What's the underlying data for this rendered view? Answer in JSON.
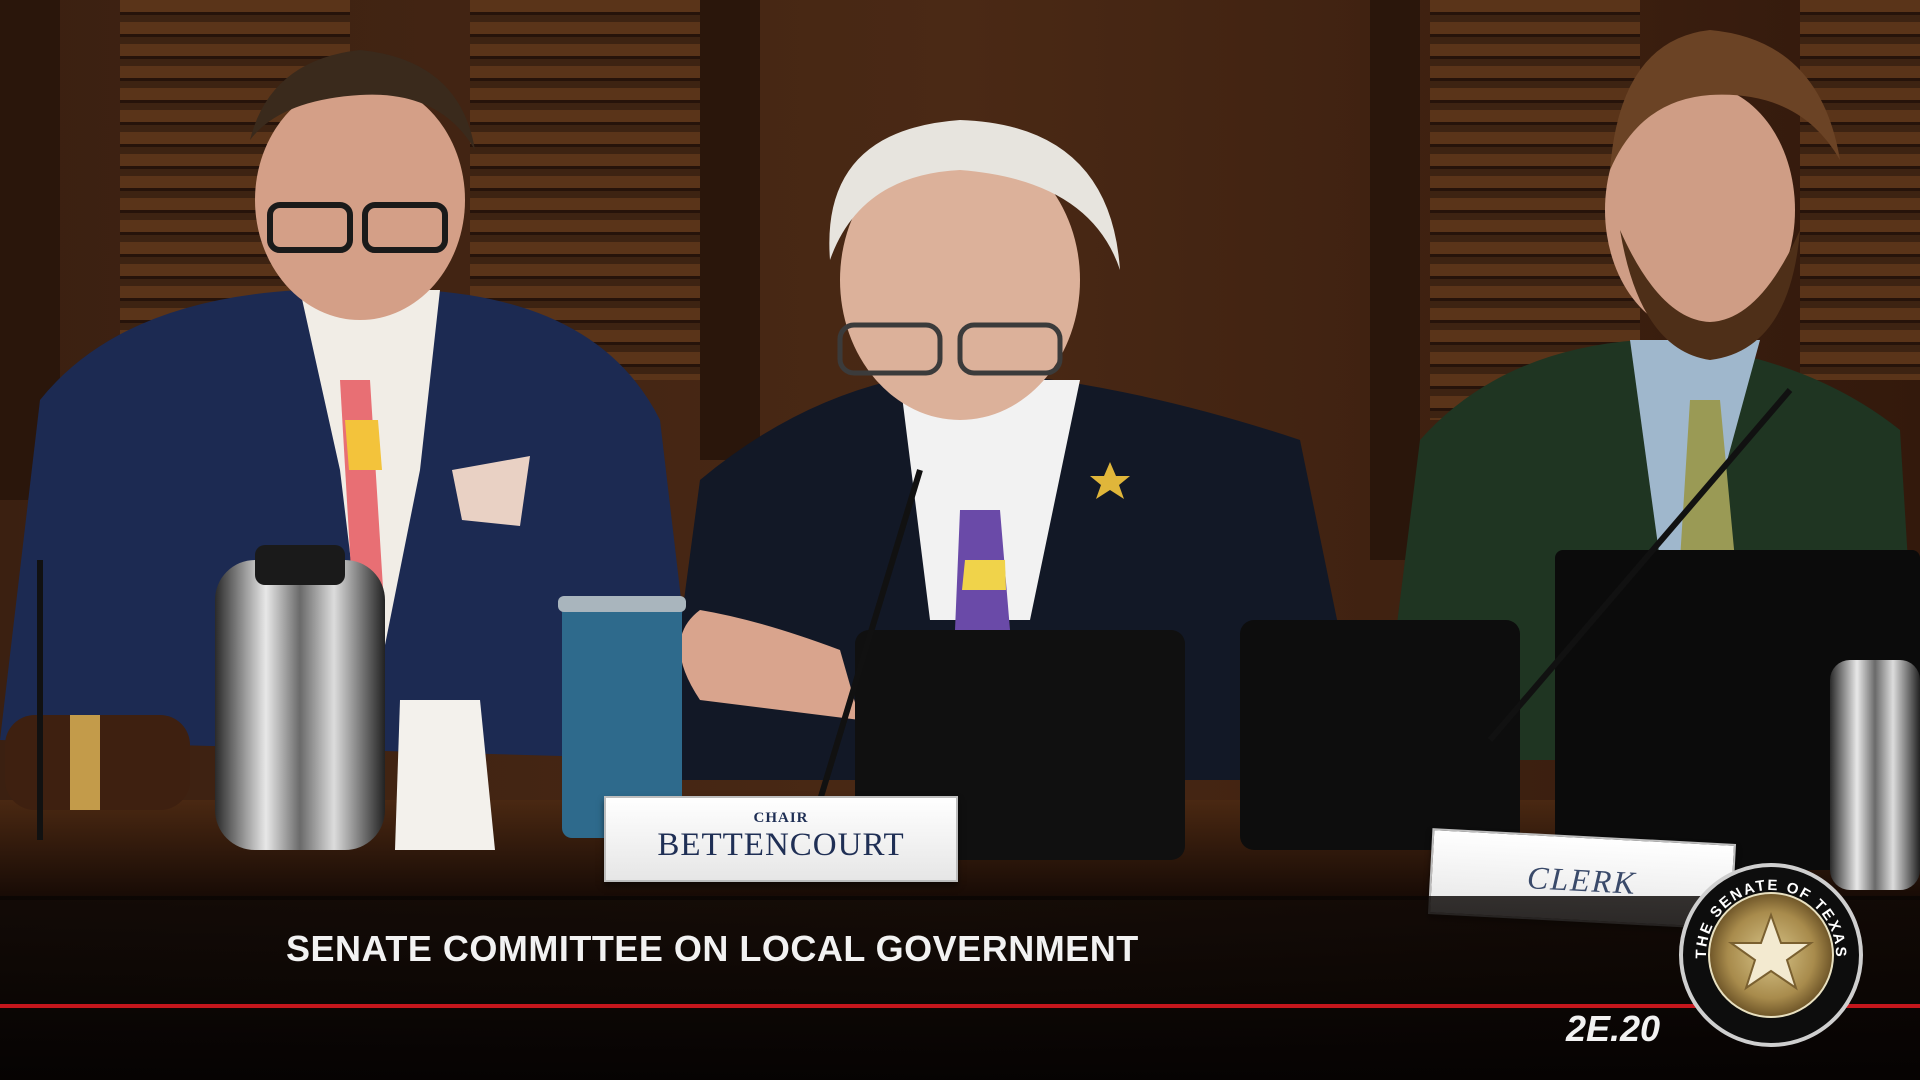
{
  "broadcast": {
    "caption": "SENATE COMMITTEE ON LOCAL GOVERNMENT",
    "program_code": "2E.20",
    "accent_color": "#c4161c"
  },
  "placards": {
    "chair_role": "CHAIR",
    "chair_name": "BETTENCOURT",
    "clerk_role": "CLERK"
  },
  "seal": {
    "text": "THE SENATE OF TEXAS",
    "icon": "texas-senate-seal-icon"
  }
}
